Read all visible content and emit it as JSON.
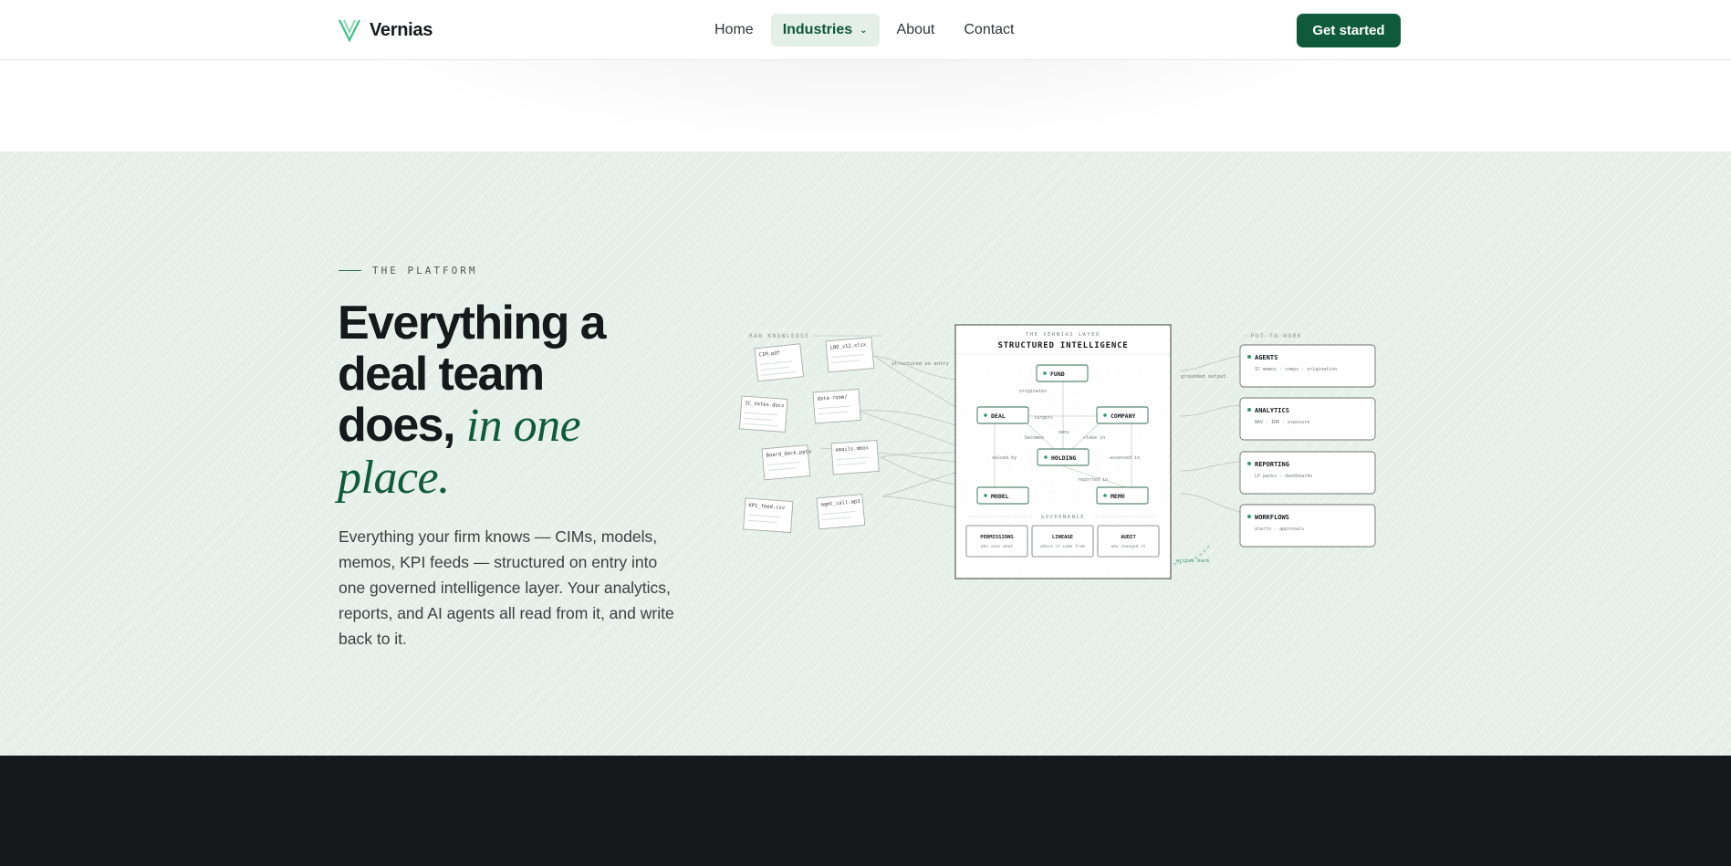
{
  "nav": {
    "brand": "Vernias",
    "links": [
      "Home",
      "Industries",
      "About",
      "Contact"
    ],
    "cta": "Get started"
  },
  "platform": {
    "eyebrow": "THE PLATFORM",
    "headline_plain": "Everything a deal team does,",
    "headline_italic": "in one place.",
    "lede": "Everything your firm knows — CIMs, models, memos, KPI feeds — structured on entry into one governed intelligence layer. Your analytics, reports, and AI agents all read from it, and write back to it."
  },
  "diagram": {
    "raw_label": "RAW KNOWLEDGE",
    "put_label": "PUT TO WORK",
    "raw_files": [
      "CIM.pdf",
      "LBO_v12.xlsx",
      "IC_notes.docx",
      "data-room/",
      "Board_deck.pptx",
      "emails.mbox",
      "KPI_feed.csv",
      "mgmt_call.mp3"
    ],
    "edge_structured": "structured on entry",
    "edge_grounded": "grounded output",
    "edge_writes_back": "writes back",
    "layer_label": "THE VERNIAS LAYER",
    "layer_title": "STRUCTURED INTELLIGENCE",
    "nodes": [
      "FUND",
      "DEAL",
      "COMPANY",
      "HOLDING",
      "MODEL",
      "MEMO"
    ],
    "relations": [
      "originates",
      "targets",
      "owns",
      "becomes",
      "stake in",
      "valued by",
      "assessed in",
      "reported in"
    ],
    "governance_label": "GOVERNANCE",
    "governance": [
      {
        "title": "PERMISSIONS",
        "sub": "who sees what"
      },
      {
        "title": "LINEAGE",
        "sub": "where it came from"
      },
      {
        "title": "AUDIT",
        "sub": "who changed it"
      }
    ],
    "outputs": [
      {
        "title": "AGENTS",
        "sub": "IC memos · comps · origination"
      },
      {
        "title": "ANALYTICS",
        "sub": "NAV · IRR · exposure"
      },
      {
        "title": "REPORTING",
        "sub": "LP packs · dashboards"
      },
      {
        "title": "WORKFLOWS",
        "sub": "alerts · approvals"
      }
    ]
  }
}
